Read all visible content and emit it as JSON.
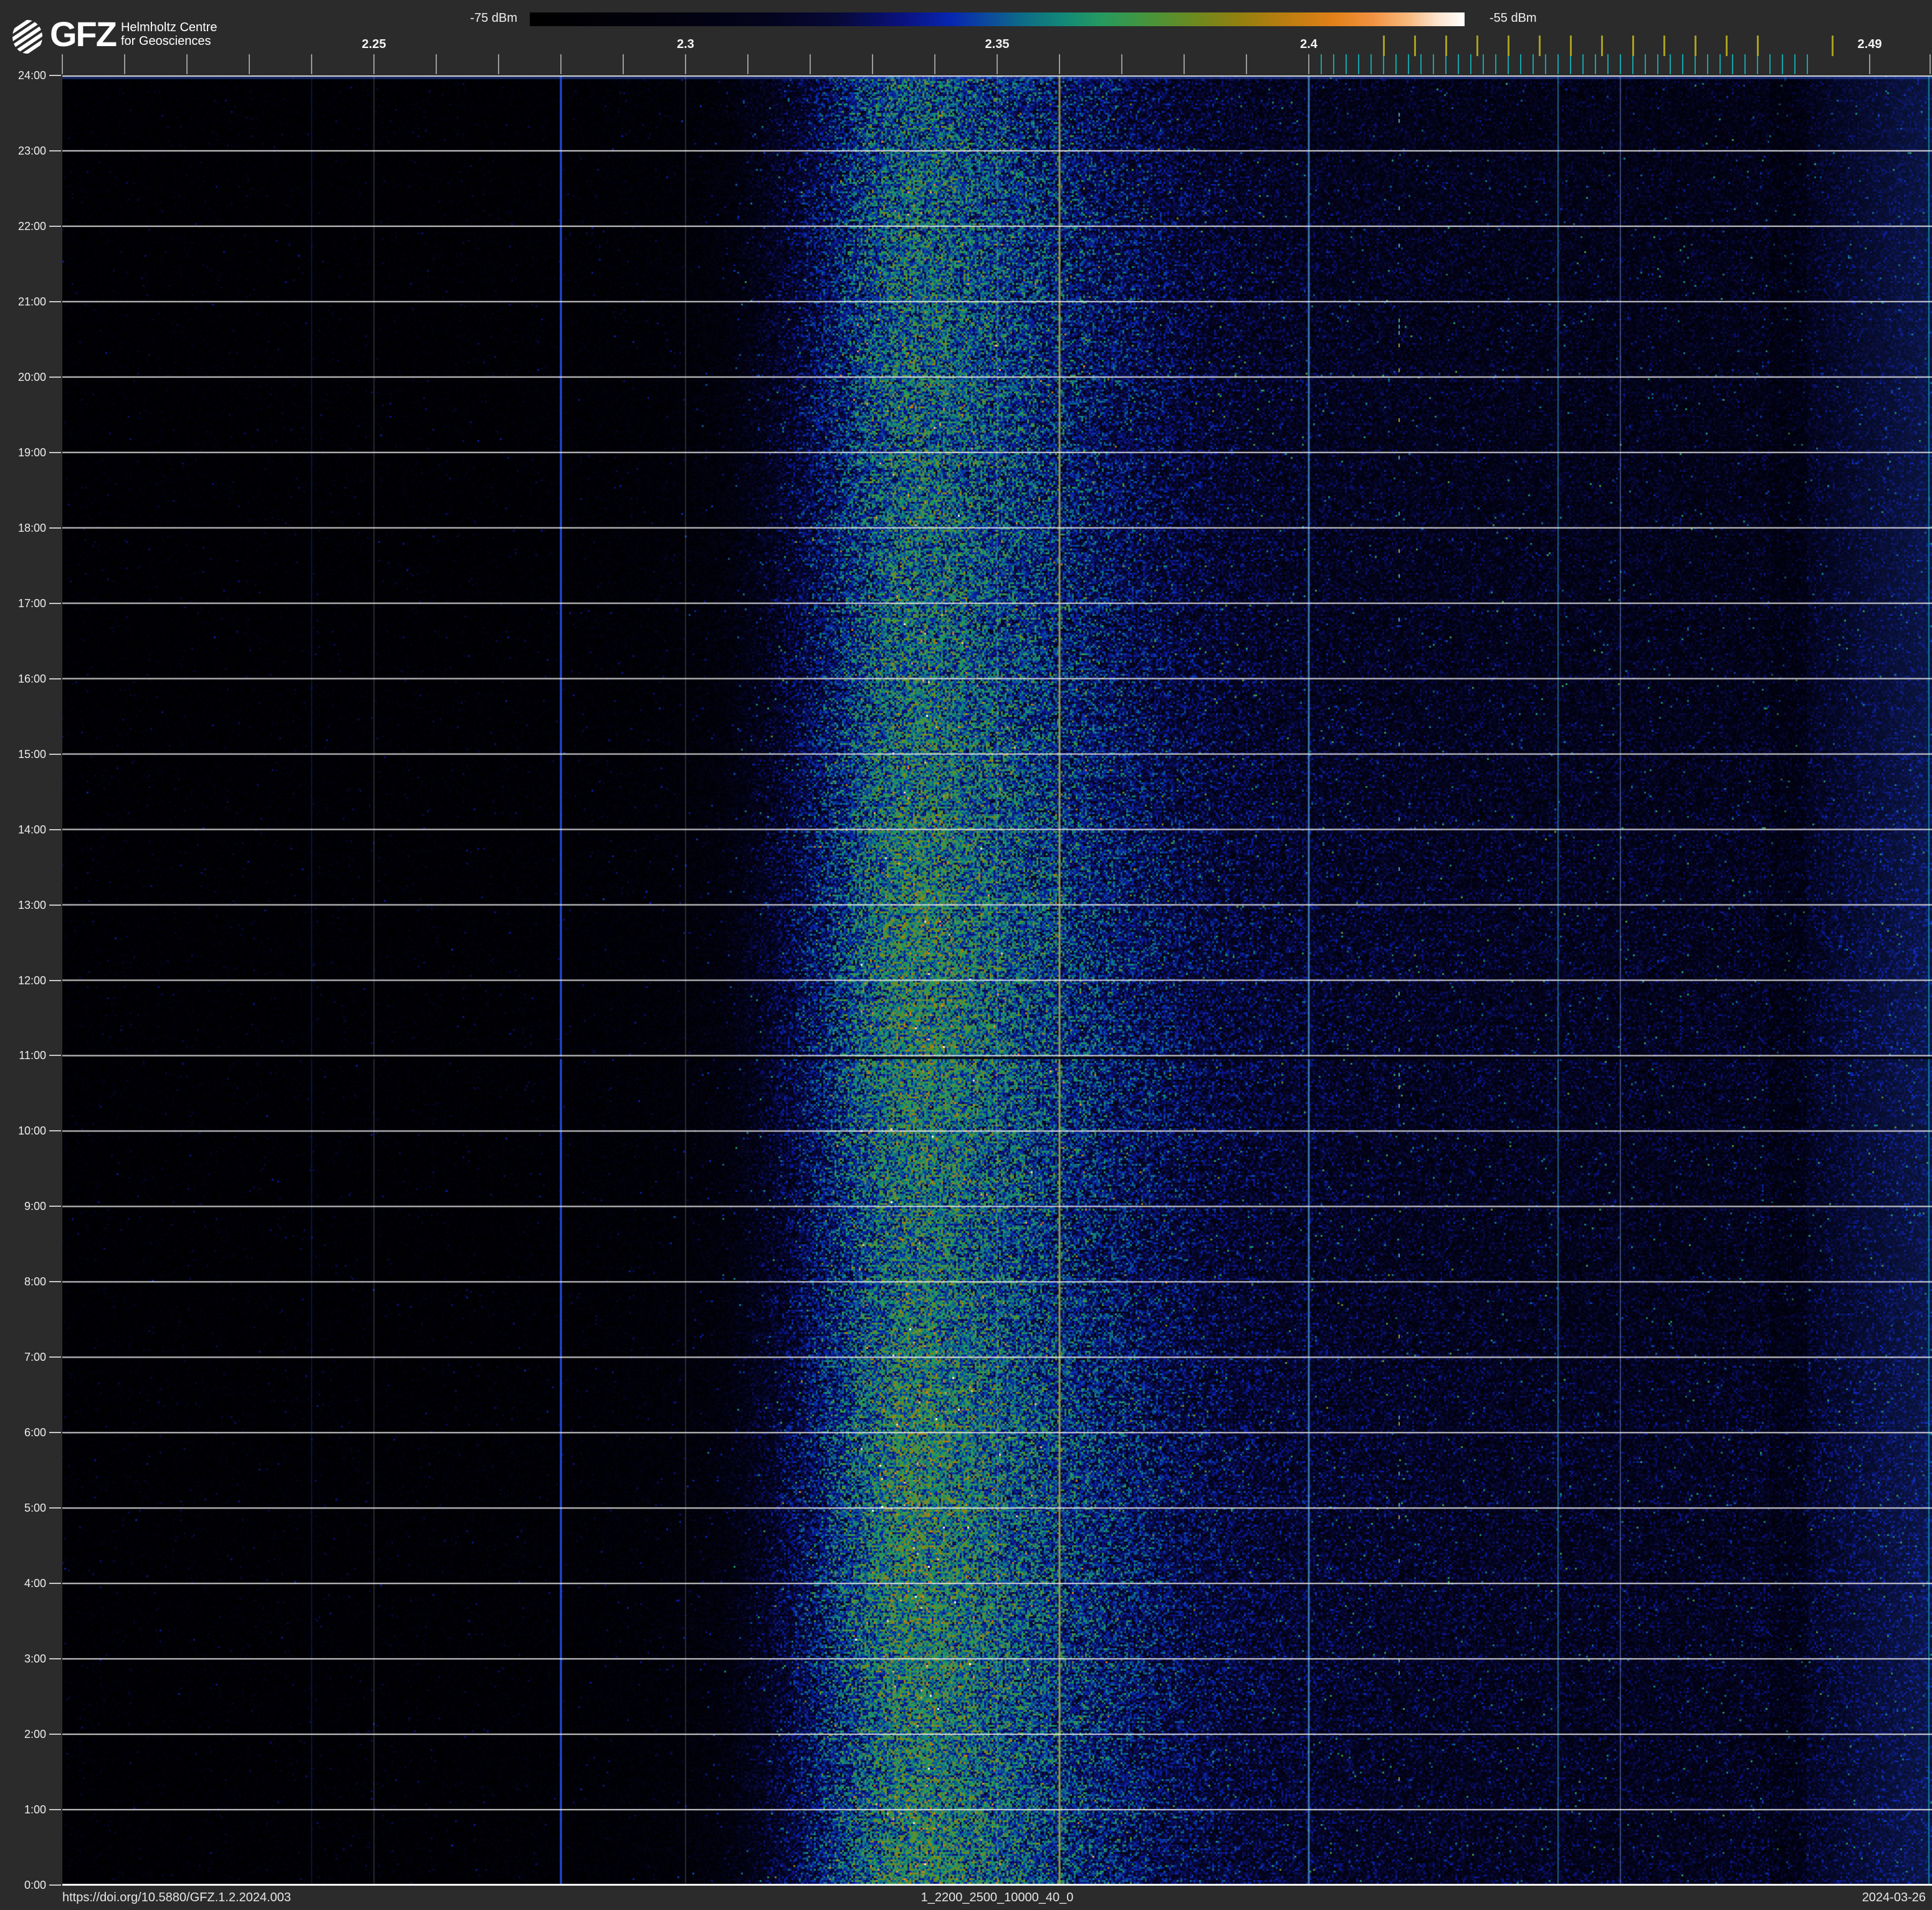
{
  "header": {
    "logo_text": "GFZ",
    "logo_subtitle_line1": "Helmholtz Centre",
    "logo_subtitle_line2": "for Geosciences"
  },
  "colorbar": {
    "min_label": "-75 dBm",
    "max_label": "-55 dBm"
  },
  "footer": {
    "doi": "https://doi.org/10.5880/GFZ.1.2.2024.003",
    "dataset_id": "1_2200_2500_10000_40_0",
    "date": "2024-03-26"
  },
  "chart_data": {
    "type": "heatmap",
    "subtype": "radio-spectrum-waterfall",
    "title": "24h radio frequency spectrogram 2.2-2.5 GHz",
    "intensity_scale": {
      "min_dbm": -75,
      "max_dbm": -55,
      "unit": "dBm"
    },
    "x_axis": {
      "quantity": "frequency_ghz",
      "min": 2.2,
      "max": 2.5,
      "minor_tick_step": 0.01,
      "labeled_ticks": [
        {
          "value": 2.25,
          "text": "2.25"
        },
        {
          "value": 2.3,
          "text": "2.3"
        },
        {
          "value": 2.35,
          "text": "2.35"
        },
        {
          "value": 2.4,
          "text": "2.4"
        },
        {
          "value": 2.49,
          "text": "2.49"
        }
      ]
    },
    "y_axis": {
      "quantity": "time_of_day",
      "top": "24:00",
      "bottom": "0:00",
      "hour_labels": [
        "24:00",
        "23:00",
        "22:00",
        "21:00",
        "20:00",
        "19:00",
        "18:00",
        "17:00",
        "16:00",
        "15:00",
        "14:00",
        "13:00",
        "12:00",
        "11:00",
        "10:00",
        "9:00",
        "8:00",
        "7:00",
        "6:00",
        "5:00",
        "4:00",
        "3:00",
        "2:00",
        "1:00",
        "0:00"
      ]
    },
    "ble_channel_ticks": {
      "start_ghz": 2.402,
      "step_ghz": 0.002,
      "count": 40,
      "color": "#14a4aa"
    },
    "wifi_channel_ticks": {
      "centers_ghz": [
        2.412,
        2.417,
        2.422,
        2.427,
        2.432,
        2.437,
        2.442,
        2.447,
        2.452,
        2.457,
        2.462,
        2.467,
        2.472,
        2.484
      ],
      "color": "#aaa01e"
    },
    "colormap_stops": [
      [
        0.0,
        "#000000"
      ],
      [
        0.1,
        "#010109"
      ],
      [
        0.18,
        "#020212"
      ],
      [
        0.26,
        "#04041f"
      ],
      [
        0.33,
        "#070938"
      ],
      [
        0.4,
        "#0a1280"
      ],
      [
        0.45,
        "#0726b0"
      ],
      [
        0.49,
        "#0c4a9c"
      ],
      [
        0.53,
        "#0e6e86"
      ],
      [
        0.57,
        "#128878"
      ],
      [
        0.61,
        "#259a60"
      ],
      [
        0.66,
        "#46953c"
      ],
      [
        0.71,
        "#6c8a20"
      ],
      [
        0.76,
        "#938010"
      ],
      [
        0.81,
        "#bc7d10"
      ],
      [
        0.86,
        "#e08118"
      ],
      [
        0.9,
        "#f29140"
      ],
      [
        0.94,
        "#f8b97e"
      ],
      [
        0.97,
        "#fbe3cb"
      ],
      [
        1.0,
        "#ffffff"
      ]
    ],
    "spectrum_profile": [
      [
        2.2,
        0.05
      ],
      [
        2.23,
        0.052
      ],
      [
        2.255,
        0.055
      ],
      [
        2.27,
        0.06
      ],
      [
        2.283,
        0.07
      ],
      [
        2.293,
        0.085
      ],
      [
        2.3,
        0.105
      ],
      [
        2.306,
        0.135
      ],
      [
        2.31,
        0.2
      ],
      [
        2.314,
        0.25
      ],
      [
        2.318,
        0.31
      ],
      [
        2.322,
        0.37
      ],
      [
        2.326,
        0.44
      ],
      [
        2.33,
        0.5
      ],
      [
        2.334,
        0.545
      ],
      [
        2.338,
        0.555
      ],
      [
        2.343,
        0.535
      ],
      [
        2.348,
        0.5
      ],
      [
        2.354,
        0.465
      ],
      [
        2.36,
        0.425
      ],
      [
        2.367,
        0.38
      ],
      [
        2.374,
        0.345
      ],
      [
        2.381,
        0.31
      ],
      [
        2.388,
        0.285
      ],
      [
        2.396,
        0.268
      ],
      [
        2.405,
        0.255
      ],
      [
        2.415,
        0.246
      ],
      [
        2.43,
        0.238
      ],
      [
        2.45,
        0.232
      ],
      [
        2.465,
        0.228
      ],
      [
        2.477,
        0.235
      ],
      [
        2.488,
        0.252
      ],
      [
        2.5,
        0.262
      ]
    ],
    "time_gain_profile": [
      [
        0,
        1.06
      ],
      [
        1,
        1.05
      ],
      [
        2,
        1.05
      ],
      [
        3,
        1.06
      ],
      [
        4,
        1.07
      ],
      [
        5,
        1.07
      ],
      [
        6,
        1.06
      ],
      [
        7,
        1.03
      ],
      [
        8,
        0.99
      ],
      [
        9,
        1.0
      ],
      [
        10,
        1.03
      ],
      [
        11,
        1.04
      ],
      [
        12,
        1.05
      ],
      [
        13,
        1.04
      ],
      [
        14,
        1.02
      ],
      [
        15,
        1.0
      ],
      [
        16,
        0.97
      ],
      [
        17,
        0.96
      ],
      [
        18,
        0.96
      ],
      [
        19,
        0.95
      ],
      [
        20,
        0.95
      ],
      [
        21,
        0.95
      ],
      [
        22,
        0.94
      ],
      [
        23,
        0.92
      ],
      [
        24,
        0.88
      ]
    ],
    "persistent_signals": [
      {
        "freq_ghz": 2.24,
        "color": "rgba(25,45,160,0.40)",
        "width": 2
      },
      {
        "freq_ghz": 2.28,
        "color": "rgba(40,90,255,0.90)",
        "width": 3
      },
      {
        "freq_ghz": 2.36,
        "color": "rgba(170,165,55,0.90)",
        "width": 3
      },
      {
        "freq_ghz": 2.4,
        "color": "rgba(45,125,195,0.80)",
        "width": 3
      },
      {
        "freq_ghz": 2.44,
        "color": "rgba(35,140,185,0.70)",
        "width": 2
      },
      {
        "freq_ghz": 2.45,
        "color": "rgba(70,110,215,0.35)",
        "width": 2
      },
      {
        "freq_ghz": 2.4995,
        "color": "rgba(20,165,180,0.75)",
        "width": 2
      }
    ],
    "burst_column": {
      "freq_ghz": 2.4145,
      "color": "rgba(90,200,210,0.85)",
      "alt_color": "rgba(190,180,60,0.9)"
    },
    "vertical_gridlines_ghz": [
      2.25,
      2.3,
      2.35,
      2.4,
      2.45
    ],
    "gap_row_hour": 11,
    "noise_seed": 1337
  }
}
